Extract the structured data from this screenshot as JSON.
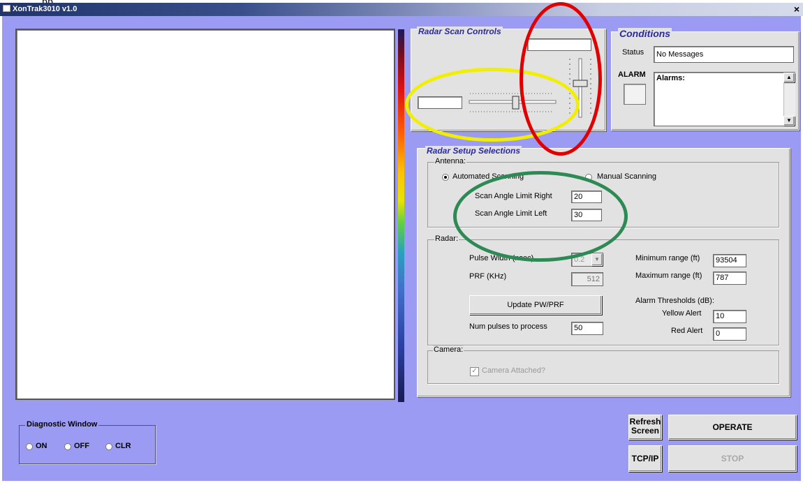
{
  "window": {
    "caption_above": "pp",
    "title": "XonTrak3010 v1.0",
    "close_glyph": "×"
  },
  "radar_scan_controls": {
    "title": "Radar Scan Controls",
    "horizontal_value": "",
    "vertical_value": ""
  },
  "conditions": {
    "title": "Conditions",
    "status_label": "Status",
    "status_value": "No Messages",
    "alarm_label": "ALARM",
    "alarms_text": "Alarms:"
  },
  "radar_setup": {
    "title": "Radar Setup Selections",
    "antenna": {
      "group_label": "Antenna:",
      "automated_label": "Automated Scanning",
      "manual_label": "Manual Scanning",
      "selected": "Automated Scanning",
      "right_label": "Scan Angle Limit Right",
      "right_value": "20",
      "left_label": "Scan Angle Limit Left",
      "left_value": "30"
    },
    "radar": {
      "group_label": "Radar:",
      "pulse_width_label": "Pulse Width (nsec)",
      "pulse_width_value": "0.2",
      "prf_label": "PRF (KHz)",
      "prf_value": "512",
      "update_label": "Update PW/PRF",
      "num_pulses_label": "Num pulses to process",
      "num_pulses_value": "50",
      "min_range_label": "Minimum range (ft)",
      "min_range_value": "93504",
      "max_range_label": "Maximum range (ft)",
      "max_range_value": "787",
      "thresholds_label": "Alarm Thresholds (dB):",
      "yellow_label": "Yellow Alert",
      "yellow_value": "10",
      "red_label": "Red Alert",
      "red_value": "0"
    },
    "camera": {
      "group_label": "Camera:",
      "attached_label": "Camera Attached?",
      "attached_checked": true
    }
  },
  "diagnostic": {
    "title": "Diagnostic Window",
    "on_label": "ON",
    "off_label": "OFF",
    "clr_label": "CLR"
  },
  "buttons": {
    "refresh_line1": "Refresh",
    "refresh_line2": "Screen",
    "operate": "OPERATE",
    "tcpip": "TCP/IP",
    "stop": "STOP"
  },
  "annotation_colors": {
    "red": "#e00000",
    "yellow": "#f2ee00",
    "green": "#2e8a55"
  },
  "colors": {
    "background": "#9b9bf4",
    "panel": "#e2e2e2",
    "panel_title": "#2a2a9c"
  }
}
